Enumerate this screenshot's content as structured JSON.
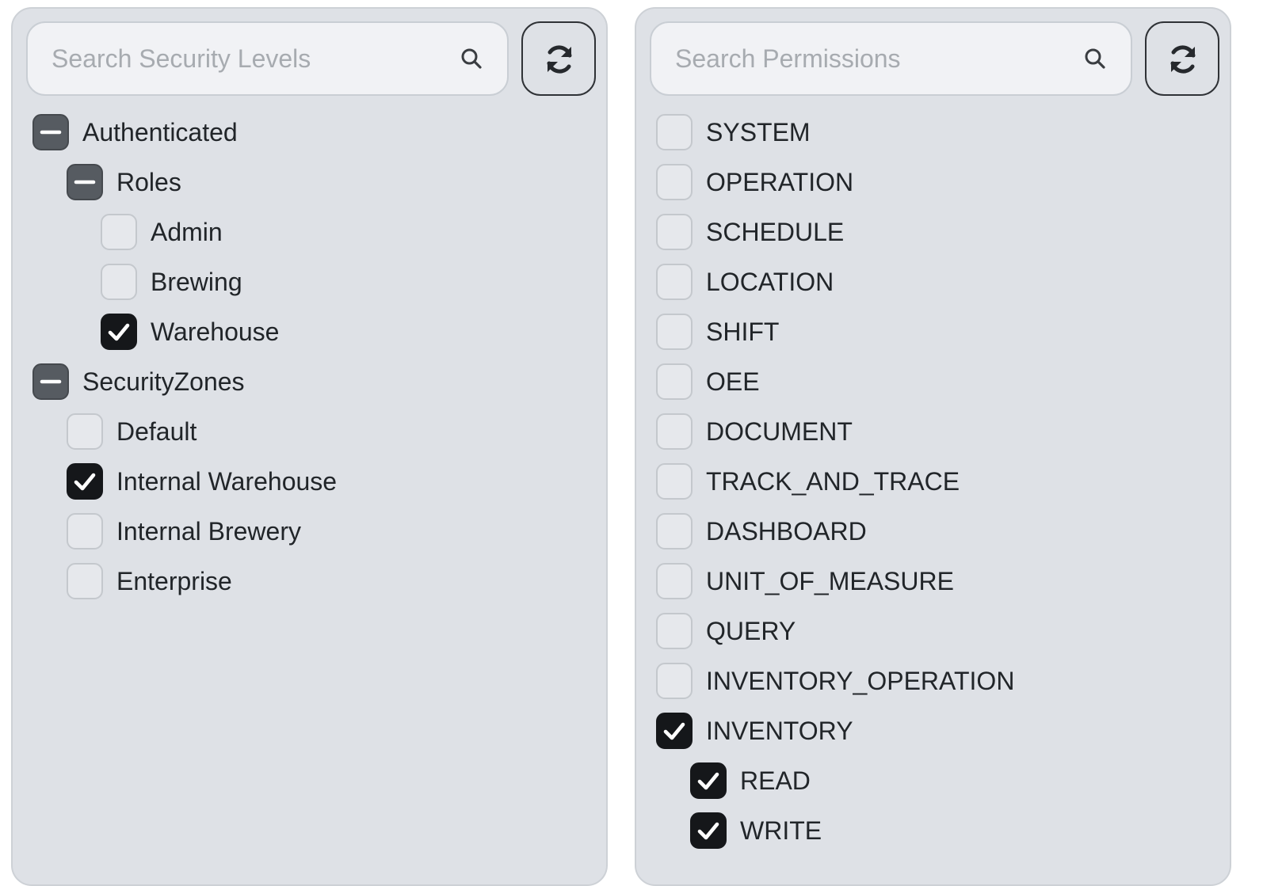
{
  "security_panel": {
    "search": {
      "placeholder": "Search Security Levels",
      "value": ""
    },
    "refresh_icon": "refresh-icon",
    "search_icon": "search-icon",
    "tree": [
      {
        "label": "Authenticated",
        "state": "partial",
        "depth": 0
      },
      {
        "label": "Roles",
        "state": "partial",
        "depth": 1
      },
      {
        "label": "Admin",
        "state": "unchecked",
        "depth": 2
      },
      {
        "label": "Brewing",
        "state": "unchecked",
        "depth": 2
      },
      {
        "label": "Warehouse",
        "state": "checked",
        "depth": 2
      },
      {
        "label": "SecurityZones",
        "state": "partial",
        "depth": 0
      },
      {
        "label": "Default",
        "state": "unchecked",
        "depth": 1
      },
      {
        "label": "Internal Warehouse",
        "state": "checked",
        "depth": 1
      },
      {
        "label": "Internal Brewery",
        "state": "unchecked",
        "depth": 1
      },
      {
        "label": "Enterprise",
        "state": "unchecked",
        "depth": 1
      }
    ]
  },
  "permissions_panel": {
    "search": {
      "placeholder": "Search Permissions",
      "value": ""
    },
    "refresh_icon": "refresh-icon",
    "search_icon": "search-icon",
    "tree": [
      {
        "label": "SYSTEM",
        "state": "unchecked",
        "depth": 0
      },
      {
        "label": "OPERATION",
        "state": "unchecked",
        "depth": 0
      },
      {
        "label": "SCHEDULE",
        "state": "unchecked",
        "depth": 0
      },
      {
        "label": "LOCATION",
        "state": "unchecked",
        "depth": 0
      },
      {
        "label": "SHIFT",
        "state": "unchecked",
        "depth": 0
      },
      {
        "label": "OEE",
        "state": "unchecked",
        "depth": 0
      },
      {
        "label": "DOCUMENT",
        "state": "unchecked",
        "depth": 0
      },
      {
        "label": "TRACK_AND_TRACE",
        "state": "unchecked",
        "depth": 0
      },
      {
        "label": "DASHBOARD",
        "state": "unchecked",
        "depth": 0
      },
      {
        "label": "UNIT_OF_MEASURE",
        "state": "unchecked",
        "depth": 0
      },
      {
        "label": "QUERY",
        "state": "unchecked",
        "depth": 0
      },
      {
        "label": "INVENTORY_OPERATION",
        "state": "unchecked",
        "depth": 0
      },
      {
        "label": "INVENTORY",
        "state": "checked",
        "depth": 0
      },
      {
        "label": "READ",
        "state": "checked",
        "depth": 1
      },
      {
        "label": "WRITE",
        "state": "checked",
        "depth": 1
      }
    ]
  },
  "colors": {
    "panel_bg": "#dee1e6",
    "checkbox_checked": "#15171a",
    "checkbox_partial": "#565b61",
    "text": "#212529",
    "placeholder": "#a7abb0"
  }
}
